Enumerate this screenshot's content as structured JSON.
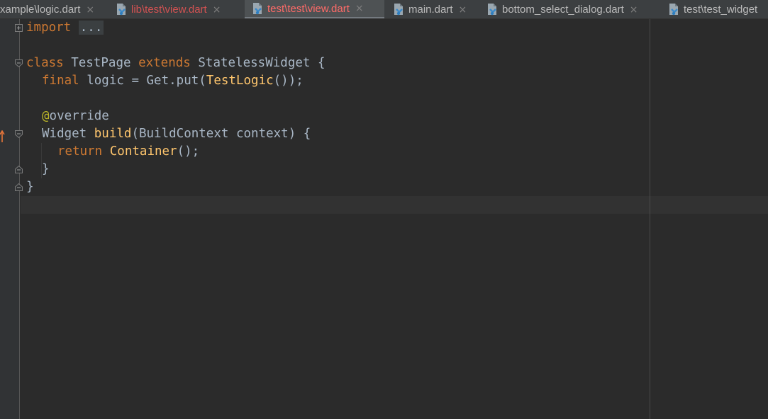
{
  "tabs": [
    {
      "label": "xample\\logic.dart",
      "state": "normal",
      "has_icon": false,
      "close": "×"
    },
    {
      "label": "lib\\test\\view.dart",
      "state": "modified",
      "has_icon": true,
      "close": "×"
    },
    {
      "label": "test\\test\\view.dart",
      "state": "active",
      "has_icon": true,
      "close": "×"
    },
    {
      "label": "main.dart",
      "state": "normal",
      "has_icon": true,
      "close": "×"
    },
    {
      "label": "bottom_select_dialog.dart",
      "state": "normal",
      "has_icon": true,
      "close": "×"
    },
    {
      "label": "test\\test_widget",
      "state": "normal",
      "has_icon": true,
      "close": ""
    }
  ],
  "code": {
    "import_kw": "import",
    "import_fold": "...",
    "class_kw": "class",
    "class_name": "TestPage",
    "extends_kw": "extends",
    "super_name": "StatelessWidget",
    "open_brace": "{",
    "final_kw": "final",
    "logic_decl": "logic = Get.put(",
    "testlogic": "TestLogic",
    "logic_end": "());",
    "semicolon": ";",
    "override_at": "@",
    "override_name": "override",
    "widget_type": "Widget",
    "build_fn": "build",
    "build_params": "(BuildContext context) {",
    "return_kw": "return",
    "container": "Container",
    "container_end": "();",
    "close_inner": "}",
    "close_outer": "}"
  },
  "colors": {
    "background": "#2b2b2b",
    "gutter": "#313335",
    "tabbar": "#3c3f41",
    "keyword": "#cc7832",
    "function": "#ffc66d",
    "text": "#a9b7c6",
    "annotation": "#bbb529",
    "modified_tab": "#d25252",
    "active_tab": "#ff6b68"
  },
  "icons": {
    "tab_icon": "dart-file-icon",
    "close_icon": "close-icon",
    "fold_icon": "fold-icon",
    "override_icon": "override-arrow-icon"
  }
}
